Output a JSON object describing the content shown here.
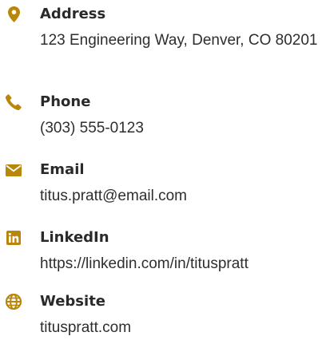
{
  "colors": {
    "accent": "#b8860b",
    "label": "#2a2a2a",
    "text": "#2e2e2e"
  },
  "contact": {
    "address": {
      "icon": "map-marker-icon",
      "label": "Address",
      "value": "123 Engineering Way, Denver, CO 80201"
    },
    "phone": {
      "icon": "phone-icon",
      "label": "Phone",
      "value": "(303) 555-0123"
    },
    "email": {
      "icon": "envelope-icon",
      "label": "Email",
      "value": "titus.pratt@email.com"
    },
    "linkedin": {
      "icon": "linkedin-icon",
      "label": "LinkedIn",
      "value": "https://linkedin.com/in/tituspratt"
    },
    "website": {
      "icon": "globe-icon",
      "label": "Website",
      "value": "tituspratt.com"
    }
  }
}
